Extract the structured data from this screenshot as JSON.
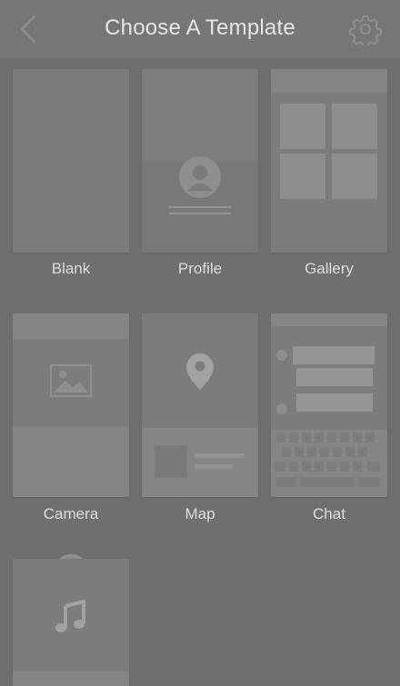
{
  "header": {
    "title": "Choose A Template",
    "back_icon": "chevron-left-icon",
    "settings_icon": "gear-icon"
  },
  "templates": [
    {
      "label": "Blank"
    },
    {
      "label": "Profile"
    },
    {
      "label": "Gallery"
    },
    {
      "label": "Camera"
    },
    {
      "label": "Map"
    },
    {
      "label": "Chat"
    },
    {
      "label": ""
    }
  ],
  "colors": {
    "background": "#6f6f6f",
    "header": "#767676",
    "card": "#7c7c7c",
    "text": "#e2e2e2"
  }
}
